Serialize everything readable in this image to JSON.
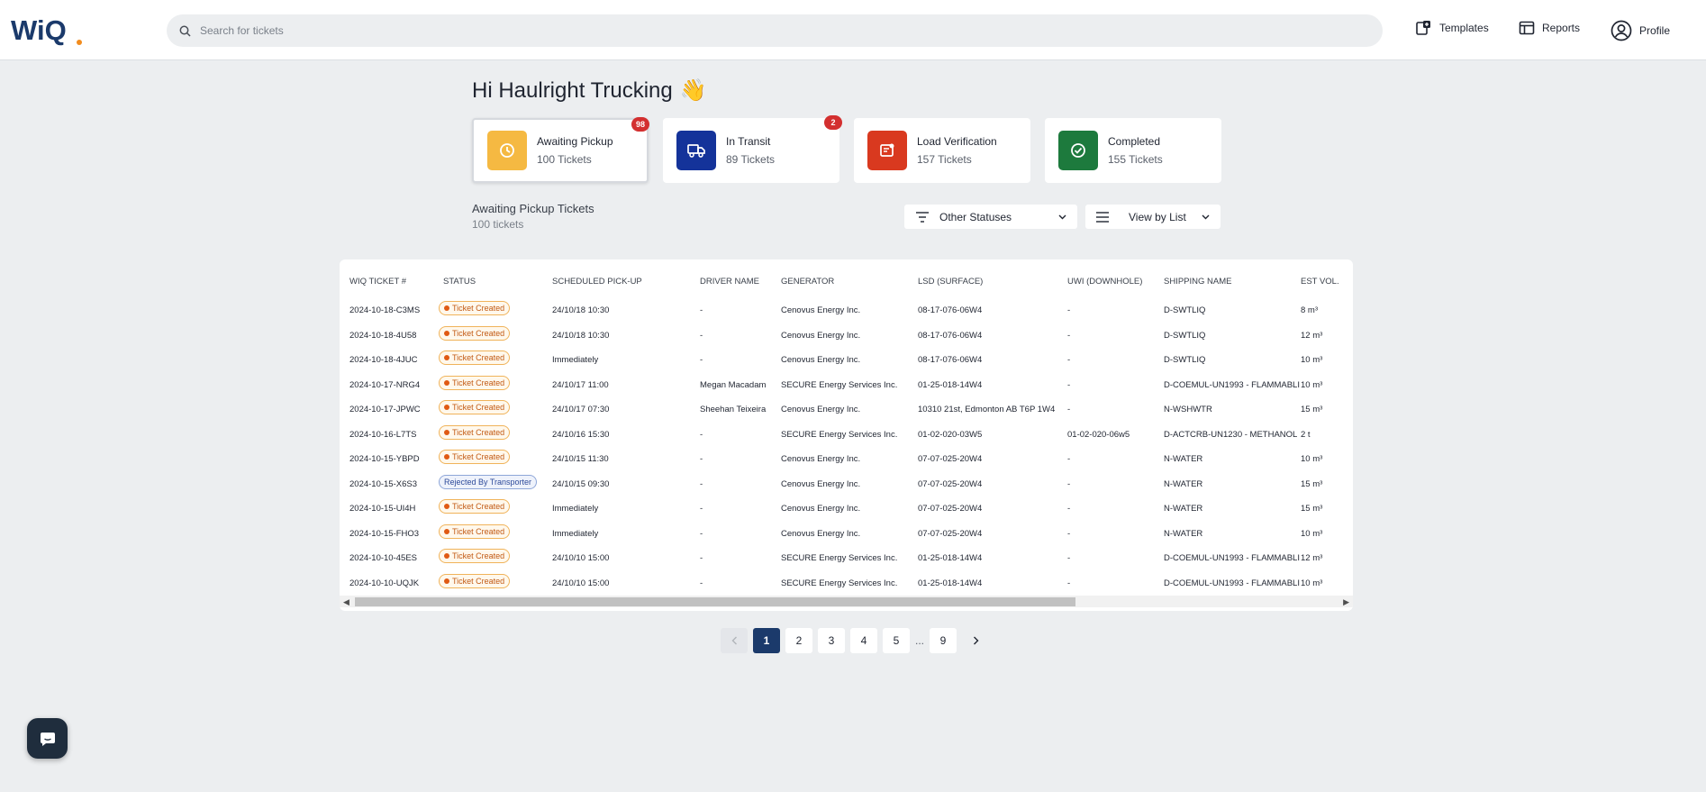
{
  "header": {
    "logo_text": "WiQ",
    "search_placeholder": "Search for tickets",
    "nav": [
      {
        "label": "Templates",
        "icon": "templates-icon"
      },
      {
        "label": "Reports",
        "icon": "reports-icon"
      },
      {
        "label": "Profile",
        "icon": "profile-icon"
      }
    ]
  },
  "greeting": {
    "text": "Hi Haulright Trucking",
    "emoji": "👋"
  },
  "cards": [
    {
      "title": "Awaiting Pickup",
      "count": "100 Tickets",
      "badge": "98",
      "color": "#f5b942",
      "icon": "clock-icon",
      "active": true
    },
    {
      "title": "In Transit",
      "count": "89 Tickets",
      "badge": "2",
      "color": "#14339a",
      "icon": "truck-icon",
      "active": false
    },
    {
      "title": "Load Verification",
      "count": "157 Tickets",
      "badge": "",
      "color": "#d9391f",
      "icon": "verification-icon",
      "active": false
    },
    {
      "title": "Completed",
      "count": "155 Tickets",
      "badge": "",
      "color": "#1d7a3d",
      "icon": "check-circle-icon",
      "active": false
    }
  ],
  "section": {
    "title": "Awaiting Pickup Tickets",
    "count": "100 tickets"
  },
  "filters": {
    "status_label": "Other Statuses",
    "view_label": "View by List"
  },
  "table": {
    "columns": [
      "WIQ TICKET #",
      "STATUS",
      "SCHEDULED PICK-UP",
      "DRIVER NAME",
      "GENERATOR",
      "LSD (SURFACE)",
      "UWI (DOWNHOLE)",
      "SHIPPING NAME",
      "EST VOL."
    ],
    "rows": [
      [
        "2024-10-18-C3MS",
        "Ticket Created",
        "24/10/18 10:30",
        "-",
        "Cenovus Energy Inc.",
        "08-17-076-06W4",
        "-",
        "D-SWTLIQ",
        "8 m³"
      ],
      [
        "2024-10-18-4U58",
        "Ticket Created",
        "24/10/18 10:30",
        "-",
        "Cenovus Energy Inc.",
        "08-17-076-06W4",
        "-",
        "D-SWTLIQ",
        "12 m³"
      ],
      [
        "2024-10-18-4JUC",
        "Ticket Created",
        "Immediately",
        "-",
        "Cenovus Energy Inc.",
        "08-17-076-06W4",
        "-",
        "D-SWTLIQ",
        "10 m³"
      ],
      [
        "2024-10-17-NRG4",
        "Ticket Created",
        "24/10/17 11:00",
        "Megan Macadam",
        "SECURE Energy Services Inc.",
        "01-25-018-14W4",
        "-",
        "D-COEMUL-UN1993 - FLAMMABLI",
        "10 m³"
      ],
      [
        "2024-10-17-JPWC",
        "Ticket Created",
        "24/10/17 07:30",
        "Sheehan Teixeira",
        "Cenovus Energy Inc.",
        "10310 21st, Edmonton AB T6P 1W4",
        "-",
        "N-WSHWTR",
        "15 m³"
      ],
      [
        "2024-10-16-L7TS",
        "Ticket Created",
        "24/10/16 15:30",
        "-",
        "SECURE Energy Services Inc.",
        "01-02-020-03W5",
        "01-02-020-06w5",
        "D-ACTCRB-UN1230 - METHANOL",
        "2 t"
      ],
      [
        "2024-10-15-YBPD",
        "Ticket Created",
        "24/10/15 11:30",
        "-",
        "Cenovus Energy Inc.",
        "07-07-025-20W4",
        "-",
        "N-WATER",
        "10 m³"
      ],
      [
        "2024-10-15-X6S3",
        "Rejected By Transporter",
        "24/10/15 09:30",
        "-",
        "Cenovus Energy Inc.",
        "07-07-025-20W4",
        "-",
        "N-WATER",
        "15 m³"
      ],
      [
        "2024-10-15-UI4H",
        "Ticket Created",
        "Immediately",
        "-",
        "Cenovus Energy Inc.",
        "07-07-025-20W4",
        "-",
        "N-WATER",
        "15 m³"
      ],
      [
        "2024-10-15-FHO3",
        "Ticket Created",
        "Immediately",
        "-",
        "Cenovus Energy Inc.",
        "07-07-025-20W4",
        "-",
        "N-WATER",
        "10 m³"
      ],
      [
        "2024-10-10-45ES",
        "Ticket Created",
        "24/10/10 15:00",
        "-",
        "SECURE Energy Services Inc.",
        "01-25-018-14W4",
        "-",
        "D-COEMUL-UN1993 - FLAMMABLI",
        "12 m³"
      ],
      [
        "2024-10-10-UQJK",
        "Ticket Created",
        "24/10/10 15:00",
        "-",
        "SECURE Energy Services Inc.",
        "01-25-018-14W4",
        "-",
        "D-COEMUL-UN1993 - FLAMMABLI",
        "10 m³"
      ]
    ]
  },
  "pagination": {
    "pages": [
      "1",
      "2",
      "3",
      "4",
      "5"
    ],
    "ellipsis": "...",
    "last": "9",
    "current": "1"
  }
}
